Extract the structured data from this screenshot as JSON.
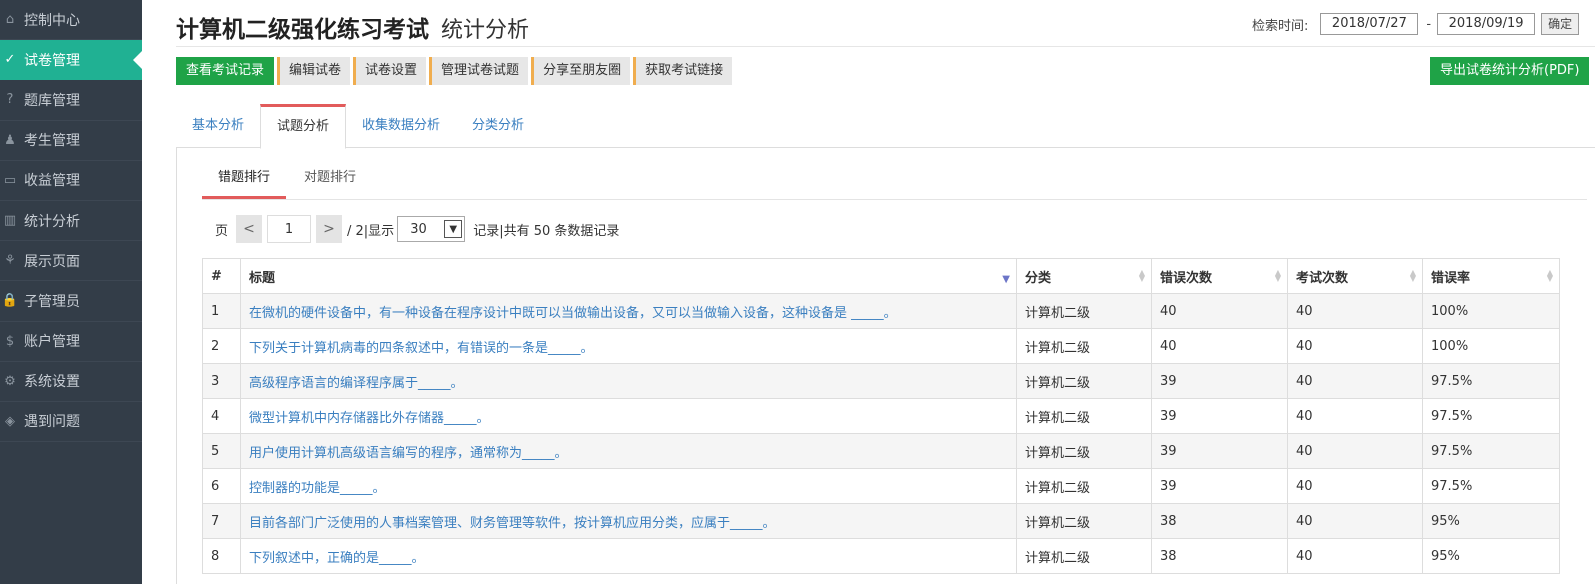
{
  "sidebar": {
    "items": [
      {
        "label": "控制中心",
        "icon": "home-icon",
        "glyph": "⌂",
        "active": false
      },
      {
        "label": "试卷管理",
        "icon": "check-circle-icon",
        "glyph": "✓",
        "active": true
      },
      {
        "label": "题库管理",
        "icon": "question-circle-icon",
        "glyph": "?",
        "active": false
      },
      {
        "label": "考生管理",
        "icon": "user-icon",
        "glyph": "♟",
        "active": false
      },
      {
        "label": "收益管理",
        "icon": "credit-card-icon",
        "glyph": "▭",
        "active": false
      },
      {
        "label": "统计分析",
        "icon": "bar-chart-icon",
        "glyph": "▥",
        "active": false
      },
      {
        "label": "展示页面",
        "icon": "leaf-icon",
        "glyph": "⚘",
        "active": false
      },
      {
        "label": "子管理员",
        "icon": "lock-icon",
        "glyph": "🔒",
        "active": false
      },
      {
        "label": "账户管理",
        "icon": "dollar-icon",
        "glyph": "$",
        "active": false
      },
      {
        "label": "系统设置",
        "icon": "gear-icon",
        "glyph": "⚙",
        "active": false
      },
      {
        "label": "遇到问题",
        "icon": "tag-icon",
        "glyph": "◈",
        "active": false
      }
    ]
  },
  "header": {
    "title": "计算机二级强化练习考试",
    "subtitle": "统计分析",
    "search_label": "检索时间:",
    "date_from": "2018/07/27",
    "date_sep": "-",
    "date_to": "2018/09/19",
    "confirm_label": "确定"
  },
  "toolbar": {
    "buttons": [
      "查看考试记录",
      "编辑试卷",
      "试卷设置",
      "管理试卷试题",
      "分享至朋友圈",
      "获取考试链接"
    ],
    "export_label": "导出试卷统计分析(PDF)"
  },
  "tabs": [
    "基本分析",
    "试题分析",
    "收集数据分析",
    "分类分析"
  ],
  "subtabs": [
    "错题排行",
    "对题排行"
  ],
  "pager": {
    "page_label": "页",
    "prev": "<",
    "current_page": "1",
    "next": ">",
    "total_text": "/ 2|显示",
    "page_size": "30",
    "summary": "记录|共有 50 条数据记录"
  },
  "table": {
    "columns": [
      "#",
      "标题",
      "分类",
      "错误次数",
      "考试次数",
      "错误率"
    ],
    "rows": [
      [
        "1",
        "在微机的硬件设备中，有一种设备在程序设计中既可以当做输出设备，又可以当做输入设备，这种设备是 _____。",
        "计算机二级",
        "40",
        "40",
        "100%"
      ],
      [
        "2",
        "下列关于计算机病毒的四条叙述中，有错误的一条是_____。",
        "计算机二级",
        "40",
        "40",
        "100%"
      ],
      [
        "3",
        "高级程序语言的编译程序属于_____。",
        "计算机二级",
        "39",
        "40",
        "97.5%"
      ],
      [
        "4",
        "微型计算机中内存储器比外存储器_____。",
        "计算机二级",
        "39",
        "40",
        "97.5%"
      ],
      [
        "5",
        "用户使用计算机高级语言编写的程序，通常称为_____。",
        "计算机二级",
        "39",
        "40",
        "97.5%"
      ],
      [
        "6",
        "控制器的功能是_____。",
        "计算机二级",
        "39",
        "40",
        "97.5%"
      ],
      [
        "7",
        "目前各部门广泛使用的人事档案管理、财务管理等软件，按计算机应用分类，应属于_____。",
        "计算机二级",
        "38",
        "40",
        "95%"
      ],
      [
        "8",
        "下列叙述中，正确的是_____。",
        "计算机二级",
        "38",
        "40",
        "95%"
      ]
    ]
  },
  "colors": {
    "sidebar_bg": "#333d48",
    "active_green": "#20b193",
    "button_green": "#1fa347",
    "tab_accent": "#e25b5b",
    "link_blue": "#3a7fc0"
  }
}
